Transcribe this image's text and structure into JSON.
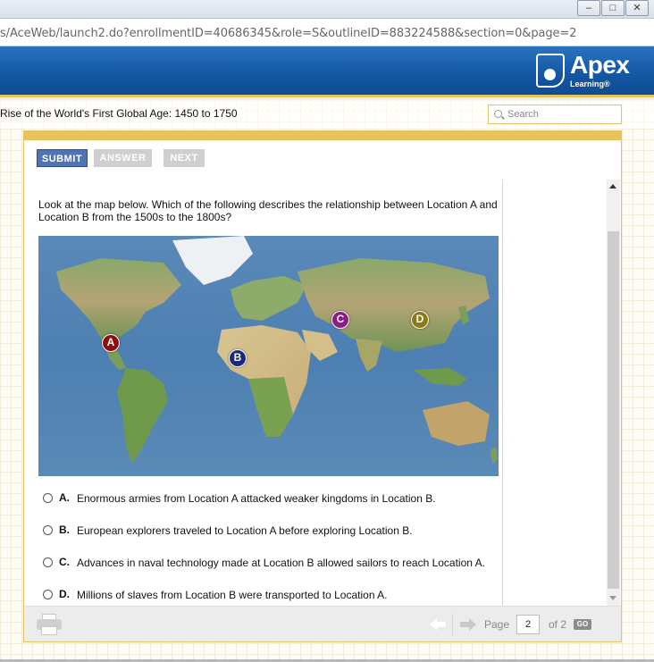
{
  "browser": {
    "url": "s/AceWeb/launch2.do?enrollmentID=40686345&role=S&outlineID=883224588&section=0&page=2",
    "window_buttons": [
      "minimize",
      "maximize",
      "close"
    ]
  },
  "header": {
    "logo_text": "Apex",
    "logo_sub": "Learning®"
  },
  "lesson": {
    "title": "Rise of the World's First Global Age: 1450 to 1750"
  },
  "search": {
    "placeholder": "Search"
  },
  "toolbar": {
    "submit_label": "SUBMIT",
    "answer_label": "ANSWER",
    "next_label": "NEXT"
  },
  "question": {
    "text": "Look at the map below. Which of the following describes the relationship between Location A and Location B from the 1500s to the 1800s?",
    "map_markers": [
      "A",
      "B",
      "C",
      "D"
    ]
  },
  "options": [
    {
      "letter": "A.",
      "text": "Enormous armies from Location A attacked weaker kingdoms in Location B."
    },
    {
      "letter": "B.",
      "text": "European explorers traveled to Location A before exploring Location B."
    },
    {
      "letter": "C.",
      "text": "Advances in naval technology made at Location B allowed sailors to reach Location A."
    },
    {
      "letter": "D.",
      "text": "Millions of slaves from Location B were transported to Location A."
    }
  ],
  "pager": {
    "page_label": "Page",
    "current_page": "2",
    "of_label": "of 2",
    "go_label": "GO"
  },
  "colors": {
    "header_blue": "#1356a3",
    "accent_gold": "#e9c35a",
    "submit_blue": "#4f74b6",
    "marker_a": "#8f0f10",
    "marker_b": "#1a2a7a",
    "marker_c": "#8e1c87",
    "marker_d": "#8c7a12"
  }
}
